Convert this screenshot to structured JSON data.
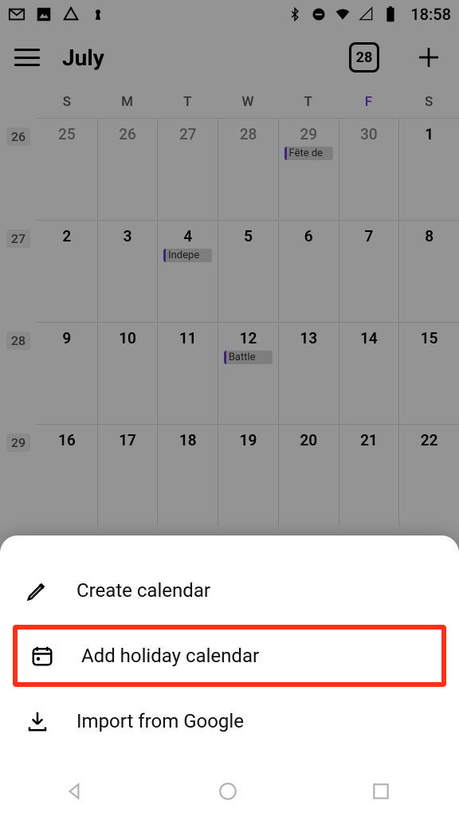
{
  "status": {
    "time": "18:58"
  },
  "header": {
    "month": "July",
    "today_num": "28"
  },
  "dow": [
    "S",
    "M",
    "T",
    "W",
    "T",
    "F",
    "S"
  ],
  "today_dow_index": 5,
  "week_nums": [
    "26",
    "27",
    "28",
    "29"
  ],
  "weeks": [
    {
      "days": [
        {
          "n": "25",
          "in": false
        },
        {
          "n": "26",
          "in": false
        },
        {
          "n": "27",
          "in": false
        },
        {
          "n": "28",
          "in": false
        },
        {
          "n": "29",
          "in": false,
          "event": "Fête de"
        },
        {
          "n": "30",
          "in": false
        },
        {
          "n": "1",
          "in": true
        }
      ]
    },
    {
      "days": [
        {
          "n": "2",
          "in": true
        },
        {
          "n": "3",
          "in": true
        },
        {
          "n": "4",
          "in": true,
          "event": "Indepe"
        },
        {
          "n": "5",
          "in": true
        },
        {
          "n": "6",
          "in": true
        },
        {
          "n": "7",
          "in": true
        },
        {
          "n": "8",
          "in": true
        }
      ]
    },
    {
      "days": [
        {
          "n": "9",
          "in": true
        },
        {
          "n": "10",
          "in": true
        },
        {
          "n": "11",
          "in": true
        },
        {
          "n": "12",
          "in": true,
          "event": "Battle"
        },
        {
          "n": "13",
          "in": true
        },
        {
          "n": "14",
          "in": true
        },
        {
          "n": "15",
          "in": true
        }
      ]
    },
    {
      "days": [
        {
          "n": "16",
          "in": true
        },
        {
          "n": "17",
          "in": true
        },
        {
          "n": "18",
          "in": true
        },
        {
          "n": "19",
          "in": true
        },
        {
          "n": "20",
          "in": true
        },
        {
          "n": "21",
          "in": true
        },
        {
          "n": "22",
          "in": true
        }
      ]
    }
  ],
  "sheet": {
    "items": [
      {
        "label": "Create calendar"
      },
      {
        "label": "Add holiday calendar"
      },
      {
        "label": "Import from Google"
      }
    ]
  },
  "colors": {
    "accent": "#6a3fd9",
    "highlight": "#ff3014"
  }
}
